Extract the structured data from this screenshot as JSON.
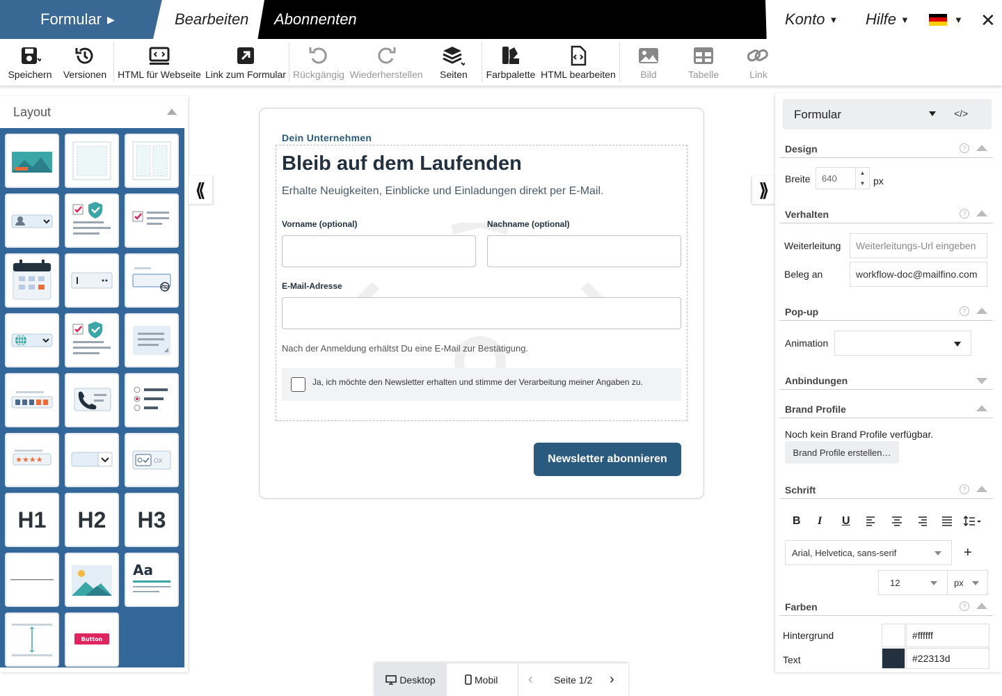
{
  "topbar": {
    "formular_tab": "Formular",
    "edit_tab": "Bearbeiten",
    "subscribers_tab": "Abonnenten",
    "account": "Konto",
    "help": "Hilfe",
    "language_flag": "de-flag-icon",
    "close": "✕"
  },
  "toolbar": {
    "save": "Speichern",
    "versions": "Versionen",
    "html_webpage": "HTML für Webseite",
    "link_form": "Link zum Formular",
    "undo": "Rückgängig",
    "redo": "Wiederherstellen",
    "pages": "Seiten",
    "palette": "Farbpalette",
    "edit_html": "HTML bearbeiten",
    "image": "Bild",
    "table": "Tabelle",
    "link": "Link"
  },
  "layout_panel": {
    "title": "Layout",
    "tiles_text": {
      "h1": "H1",
      "h2": "H2",
      "h3": "H3",
      "aa": "Aa",
      "button": "Button",
      "ox": "OX"
    }
  },
  "form": {
    "company": "Dein Unternehmen",
    "title": "Bleib auf dem Laufenden",
    "subtitle": "Erhalte Neuigkeiten, Einblicke und Einladungen direkt per E-Mail.",
    "firstname_label": "Vorname (optional)",
    "lastname_label": "Nachname (optional)",
    "email_label": "E-Mail-Adresse",
    "note": "Nach der Anmeldung erhältst Du eine E-Mail zur Bestätigung.",
    "consent": "Ja, ich möchte den Newsletter erhalten und stimme der Verarbeitung meiner Angaben zu.",
    "submit": "Newsletter abonnieren"
  },
  "properties": {
    "element_select": "Formular",
    "code_icon": "</>",
    "design": {
      "title": "Design",
      "width_label": "Breite",
      "width_value": "640",
      "unit": "px"
    },
    "behavior": {
      "title": "Verhalten",
      "redirect_label": "Weiterleitung",
      "redirect_placeholder": "Weiterleitungs-Url eingeben",
      "receipt_label": "Beleg an",
      "receipt_value": "workflow-doc@mailfino.com"
    },
    "popup": {
      "title": "Pop-up",
      "animation_label": "Animation",
      "animation_value": ""
    },
    "integrations": {
      "title": "Anbindungen"
    },
    "brand": {
      "title": "Brand Profile",
      "text": "Noch kein Brand Profile verfügbar.",
      "button": "Brand Profile erstellen…"
    },
    "font": {
      "title": "Schrift",
      "bold": "B",
      "italic": "I",
      "underline": "U",
      "family": "Arial, Helvetica, sans-serif",
      "add": "+",
      "size": "12",
      "size_unit": "px"
    },
    "colors": {
      "title": "Farben",
      "bg_label": "Hintergrund",
      "bg_value": "#ffffff",
      "text_label": "Text",
      "text_value": "#22313d"
    },
    "help_mark": "?"
  },
  "bottombar": {
    "desktop": "Desktop",
    "mobile": "Mobil",
    "page": "Seite 1/2",
    "prev": "‹",
    "next": "›"
  },
  "colors": {
    "brand_blue": "#3a6895",
    "panel_blue": "#336699",
    "button_blue": "#2a5a7e",
    "text_dark": "#22313d"
  }
}
